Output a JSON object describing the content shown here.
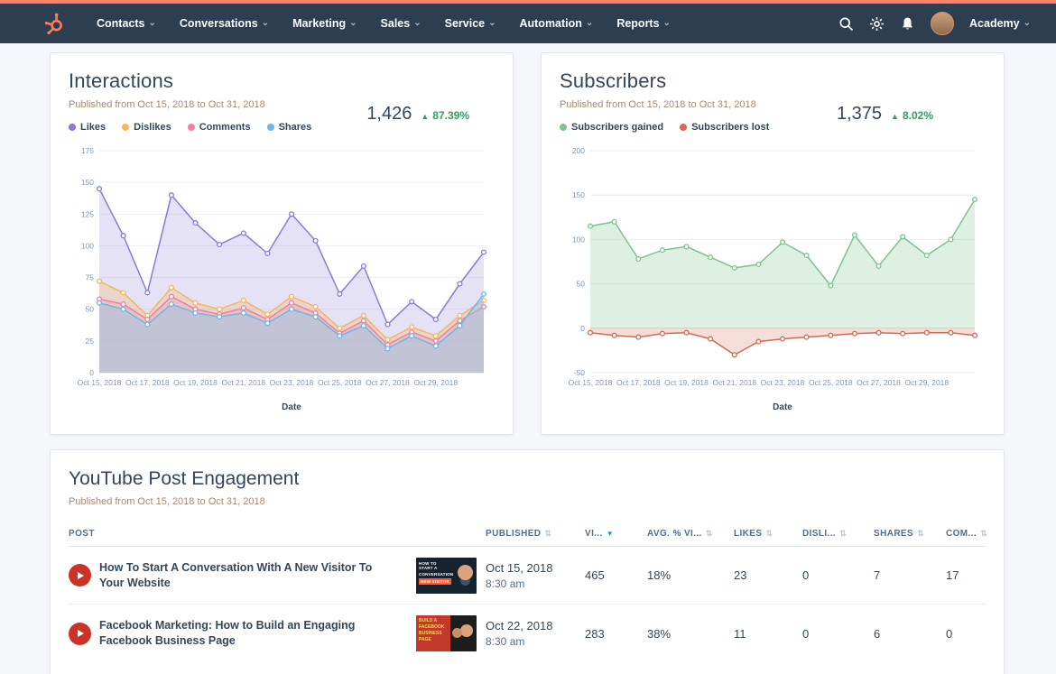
{
  "colors": {
    "accent": "#ff7a59",
    "navbar_bg": "#2d3e50",
    "positive_delta": "#2e9e5e",
    "sort_active": "#00a4bd",
    "background": "#f5f7fa"
  },
  "icons": {
    "chevron": "⌄",
    "delta_up": "▲",
    "sort": "⇅",
    "sort_active": "▼"
  },
  "navbar": {
    "items": [
      "Contacts",
      "Conversations",
      "Marketing",
      "Sales",
      "Service",
      "Automation",
      "Reports"
    ],
    "academy": "Academy",
    "right_icons": [
      "search-icon",
      "settings-icon",
      "notifications-icon",
      "user-avatar"
    ]
  },
  "interactions": {
    "title": "Interactions",
    "subtitle": "Published from Oct 15, 2018 to Oct 31, 2018",
    "total": "1,426",
    "delta": "87.39%"
  },
  "subscribers": {
    "title": "Subscribers",
    "subtitle": "Published from Oct 15, 2018 to Oct 31, 2018",
    "total": "1,375",
    "delta": "8.02%"
  },
  "engagement": {
    "title": "YouTube Post Engagement",
    "subtitle": "Published from Oct 15, 2018 to Oct 31, 2018",
    "columns": [
      "POST",
      "PUBLISHED",
      "VI...",
      "AVG. % VI...",
      "LIKES",
      "DISLI...",
      "SHARES",
      "COM..."
    ],
    "rows": [
      {
        "post": "How To Start A Conversation With A New Visitor To Your Website",
        "thumb": {
          "l1": "HOW TO START A",
          "l2": "CONVERSATION",
          "badge": "NEW VISITOR"
        },
        "published_date": "Oct 15, 2018",
        "published_time": "8:30 am",
        "views": "465",
        "avg_viewed": "18%",
        "likes": "23",
        "dislikes": "0",
        "shares": "7",
        "comments": "17"
      },
      {
        "post": "Facebook Marketing: How to Build an Engaging Facebook Business Page",
        "thumb": {
          "l1": "BUILD A",
          "l2": "FACEBOOK",
          "l3": "BUSINESS",
          "l4": "PAGE"
        },
        "published_date": "Oct 22, 2018",
        "published_time": "8:30 am",
        "views": "283",
        "avg_viewed": "38%",
        "likes": "11",
        "dislikes": "0",
        "shares": "6",
        "comments": "0"
      }
    ]
  },
  "chart_data": [
    {
      "id": "interactions",
      "type": "area",
      "title": "Interactions",
      "xlabel": "Date",
      "ylim": [
        0,
        175
      ],
      "yticks": [
        0,
        25,
        50,
        75,
        100,
        125,
        150,
        175
      ],
      "grid": true,
      "legend_position": "top-left",
      "x": [
        "Oct 15, 2018",
        "Oct 16, 2018",
        "Oct 17, 2018",
        "Oct 18, 2018",
        "Oct 19, 2018",
        "Oct 20, 2018",
        "Oct 21, 2018",
        "Oct 22, 2018",
        "Oct 23, 2018",
        "Oct 24, 2018",
        "Oct 25, 2018",
        "Oct 26, 2018",
        "Oct 27, 2018",
        "Oct 28, 2018",
        "Oct 29, 2018",
        "Oct 30, 2018",
        "Oct 31, 2018"
      ],
      "series": [
        {
          "name": "Likes",
          "color": "#8b7ad8",
          "fill": "rgba(139,122,216,0.22)",
          "values": [
            145,
            108,
            63,
            140,
            118,
            101,
            110,
            94,
            125,
            104,
            62,
            84,
            38,
            56,
            42,
            70,
            95
          ]
        },
        {
          "name": "Dislikes",
          "color": "#f3b65f",
          "fill": "rgba(243,182,95,0.30)",
          "values": [
            72,
            63,
            45,
            67,
            55,
            50,
            57,
            46,
            60,
            52,
            35,
            45,
            26,
            36,
            29,
            45,
            57
          ]
        },
        {
          "name": "Comments",
          "color": "#ef7fa3",
          "fill": "rgba(239,127,163,0.22)",
          "values": [
            58,
            54,
            42,
            60,
            50,
            46,
            51,
            42,
            55,
            47,
            31,
            41,
            22,
            32,
            25,
            41,
            52
          ]
        },
        {
          "name": "Shares",
          "color": "#6fb5e8",
          "fill": "rgba(146,197,235,0.45)",
          "values": [
            55,
            50,
            38,
            54,
            47,
            44,
            47,
            39,
            50,
            44,
            29,
            37,
            19,
            29,
            21,
            37,
            62
          ]
        }
      ]
    },
    {
      "id": "subscribers",
      "type": "area",
      "title": "Subscribers",
      "xlabel": "Date",
      "ylim": [
        -50,
        200
      ],
      "yticks": [
        -50,
        0,
        50,
        100,
        150,
        200
      ],
      "grid": true,
      "legend_position": "top-left",
      "x": [
        "Oct 15, 2018",
        "Oct 16, 2018",
        "Oct 17, 2018",
        "Oct 18, 2018",
        "Oct 19, 2018",
        "Oct 20, 2018",
        "Oct 21, 2018",
        "Oct 22, 2018",
        "Oct 23, 2018",
        "Oct 24, 2018",
        "Oct 25, 2018",
        "Oct 26, 2018",
        "Oct 27, 2018",
        "Oct 28, 2018",
        "Oct 29, 2018",
        "Oct 30, 2018",
        "Oct 31, 2018"
      ],
      "series": [
        {
          "name": "Subscribers gained",
          "color": "#7dc38c",
          "fill": "rgba(125,195,140,0.25)",
          "values": [
            115,
            120,
            78,
            88,
            92,
            80,
            68,
            72,
            97,
            82,
            48,
            105,
            70,
            103,
            82,
            100,
            145
          ]
        },
        {
          "name": "Subscribers lost",
          "color": "#d56a4f",
          "fill": "rgba(213,106,79,0.22)",
          "values": [
            -5,
            -8,
            -10,
            -6,
            -5,
            -12,
            -30,
            -15,
            -12,
            -10,
            -8,
            -6,
            -5,
            -6,
            -5,
            -5,
            -8
          ]
        }
      ]
    }
  ]
}
